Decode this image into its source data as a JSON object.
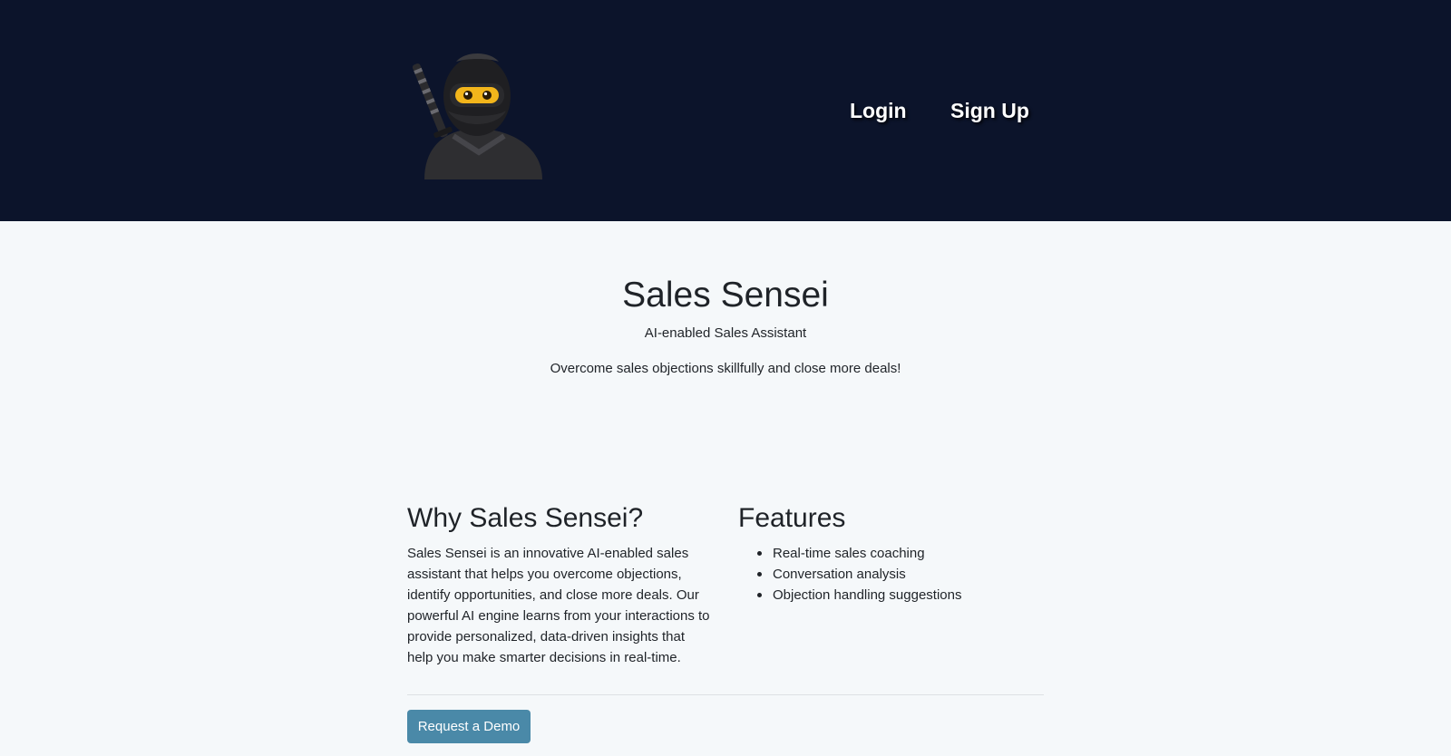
{
  "header": {
    "logo_icon": "ninja-icon",
    "login_label": "Login",
    "signup_label": "Sign Up",
    "background_color": "#0c142b"
  },
  "hero": {
    "title": "Sales Sensei",
    "subtitle": "AI-enabled Sales Assistant",
    "tagline": "Overcome sales objections skillfully and close more deals!"
  },
  "why": {
    "title": "Why Sales Sensei?",
    "text": "Sales Sensei is an innovative AI-enabled sales assistant that helps you overcome objections, identify opportunities, and close more deals. Our powerful AI engine learns from your interactions to provide personalized, data-driven insights that help you make smarter decisions in real-time."
  },
  "features": {
    "title": "Features",
    "items": [
      "Real-time sales coaching",
      "Conversation analysis",
      "Objection handling suggestions"
    ]
  },
  "cta": {
    "demo_label": "Request a Demo",
    "button_color": "#4a89a8"
  }
}
